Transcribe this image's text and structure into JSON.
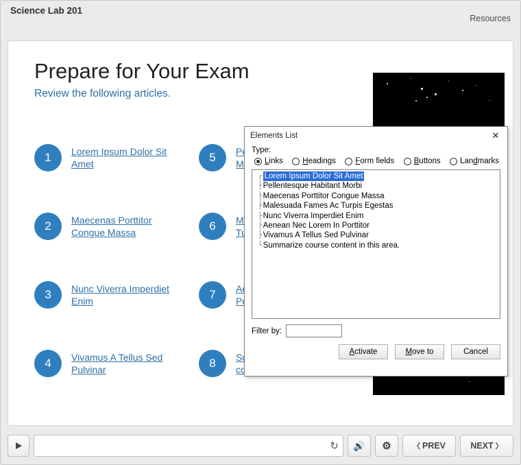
{
  "app_title": "Science Lab 201",
  "resources_label": "Resources",
  "page": {
    "title": "Prepare for Your Exam",
    "subtitle": "Review the following articles."
  },
  "links": [
    {
      "n": "1",
      "label": "Lorem Ipsum Dolor Sit Amet"
    },
    {
      "n": "2",
      "label": "Maecenas Porttitor Congue Massa"
    },
    {
      "n": "3",
      "label": "Nunc Viverra Imperdiet Enim"
    },
    {
      "n": "4",
      "label": "Vivamus A Tellus Sed Pulvinar"
    },
    {
      "n": "5",
      "label": "Pellentesque Habitant Morbi"
    },
    {
      "n": "6",
      "label": "Malesuada Fames Ac Turpis Egestas"
    },
    {
      "n": "7",
      "label": "Aenean Nec Lorem In Porttitor"
    },
    {
      "n": "8",
      "label": "Summarize course content in this area."
    }
  ],
  "bottombar": {
    "prev": "PREV",
    "next": "NEXT"
  },
  "dialog": {
    "title": "Elements List",
    "type_label": "Type:",
    "options": {
      "links": "Links",
      "headings": "Headings",
      "form": "Form fields",
      "buttons": "Buttons",
      "landmarks": "Landmarks"
    },
    "selected_option": "links",
    "items": [
      "Lorem Ipsum Dolor Sit Amet",
      "Pellentesque Habitant Morbi",
      "Maecenas Porttitor Congue Massa",
      "Malesuada Fames Ac Turpis Egestas",
      "Nunc Viverra Imperdiet Enim",
      "Aenean Nec Lorem In Porttitor",
      "Vivamus A Tellus Sed Pulvinar",
      "Summarize course content in this area."
    ],
    "selected_index": 0,
    "filter_label": "Filter by:",
    "filter_value": "",
    "buttons": {
      "activate": "Activate",
      "moveto": "Move to",
      "cancel": "Cancel"
    }
  }
}
